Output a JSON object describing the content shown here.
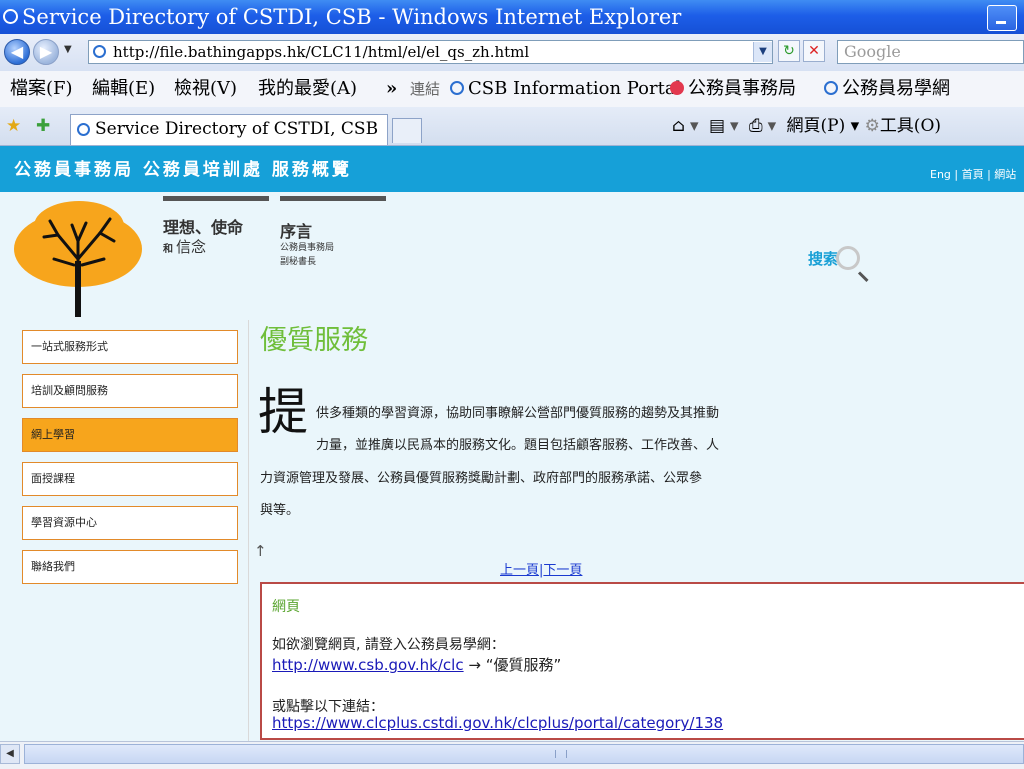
{
  "window": {
    "title": "Service Directory of CSTDI, CSB - Windows Internet Explorer"
  },
  "address": {
    "url": "http://file.bathingapps.hk/CLC11/html/el/el_qs_zh.html",
    "search_placeholder": "Google"
  },
  "menu": {
    "items": [
      "檔案(F)",
      "編輯(E)",
      "檢視(V)",
      "我的最愛(A)"
    ],
    "chevron": "»",
    "links_label": "連結",
    "links": [
      "CSB Information Portal",
      "公務員事務局",
      "公務員易學網"
    ]
  },
  "tabs": {
    "active_title": "Service Directory of CSTDI, CSB",
    "page_menu": "網頁(P)",
    "tools_menu": "工具(O)"
  },
  "banner": {
    "title": "公務員事務局 公務員培訓處 服務概覽",
    "links": "Eng | 首頁 | 網站"
  },
  "topnav": {
    "vision": {
      "line1": "理想、使命",
      "prefix": "和",
      "line2": "信念"
    },
    "preface": {
      "title": "序言",
      "sub1": "公務員事務局",
      "sub2": "副秘書長"
    }
  },
  "search_label": "搜索",
  "sidenav": {
    "items": [
      {
        "label": "一站式服務形式",
        "active": false
      },
      {
        "label": "培訓及顧問服務",
        "active": false
      },
      {
        "label": "網上學習",
        "active": true
      },
      {
        "label": "面授課程",
        "active": false
      },
      {
        "label": "學習資源中心",
        "active": false
      },
      {
        "label": "聯絡我們",
        "active": false
      }
    ]
  },
  "content": {
    "title": "優質服務",
    "dropcap": "提",
    "lines": [
      "供多種類的學習資源，協助同事瞭解公營部門優質服務的趨勢及其推動",
      "力量，並推廣以民爲本的服務文化。題目包括顧客服務、工作改善、人",
      "力資源管理及發展、公務員優質服務獎勵計劃、政府部門的服務承諾、公眾參",
      "與等。"
    ],
    "up_arrow": "↑",
    "prev": "上一頁",
    "separator": "|",
    "next": "下一頁"
  },
  "infobox": {
    "heading": "網頁",
    "line1": "如欲瀏覽網頁, 請登入公務員易學網：",
    "link1": "http://www.csb.gov.hk/clc",
    "arrow_text": " → “優質服務”",
    "line2": "或點擊以下連結：",
    "link2": "https://www.clcplus.cstdi.gov.hk/clcplus/portal/category/138"
  },
  "colors": {
    "banner": "#16a0d8",
    "accent_orange": "#f7a51c",
    "title_green": "#6fbe3a",
    "page_bg": "#eaf6fb"
  }
}
